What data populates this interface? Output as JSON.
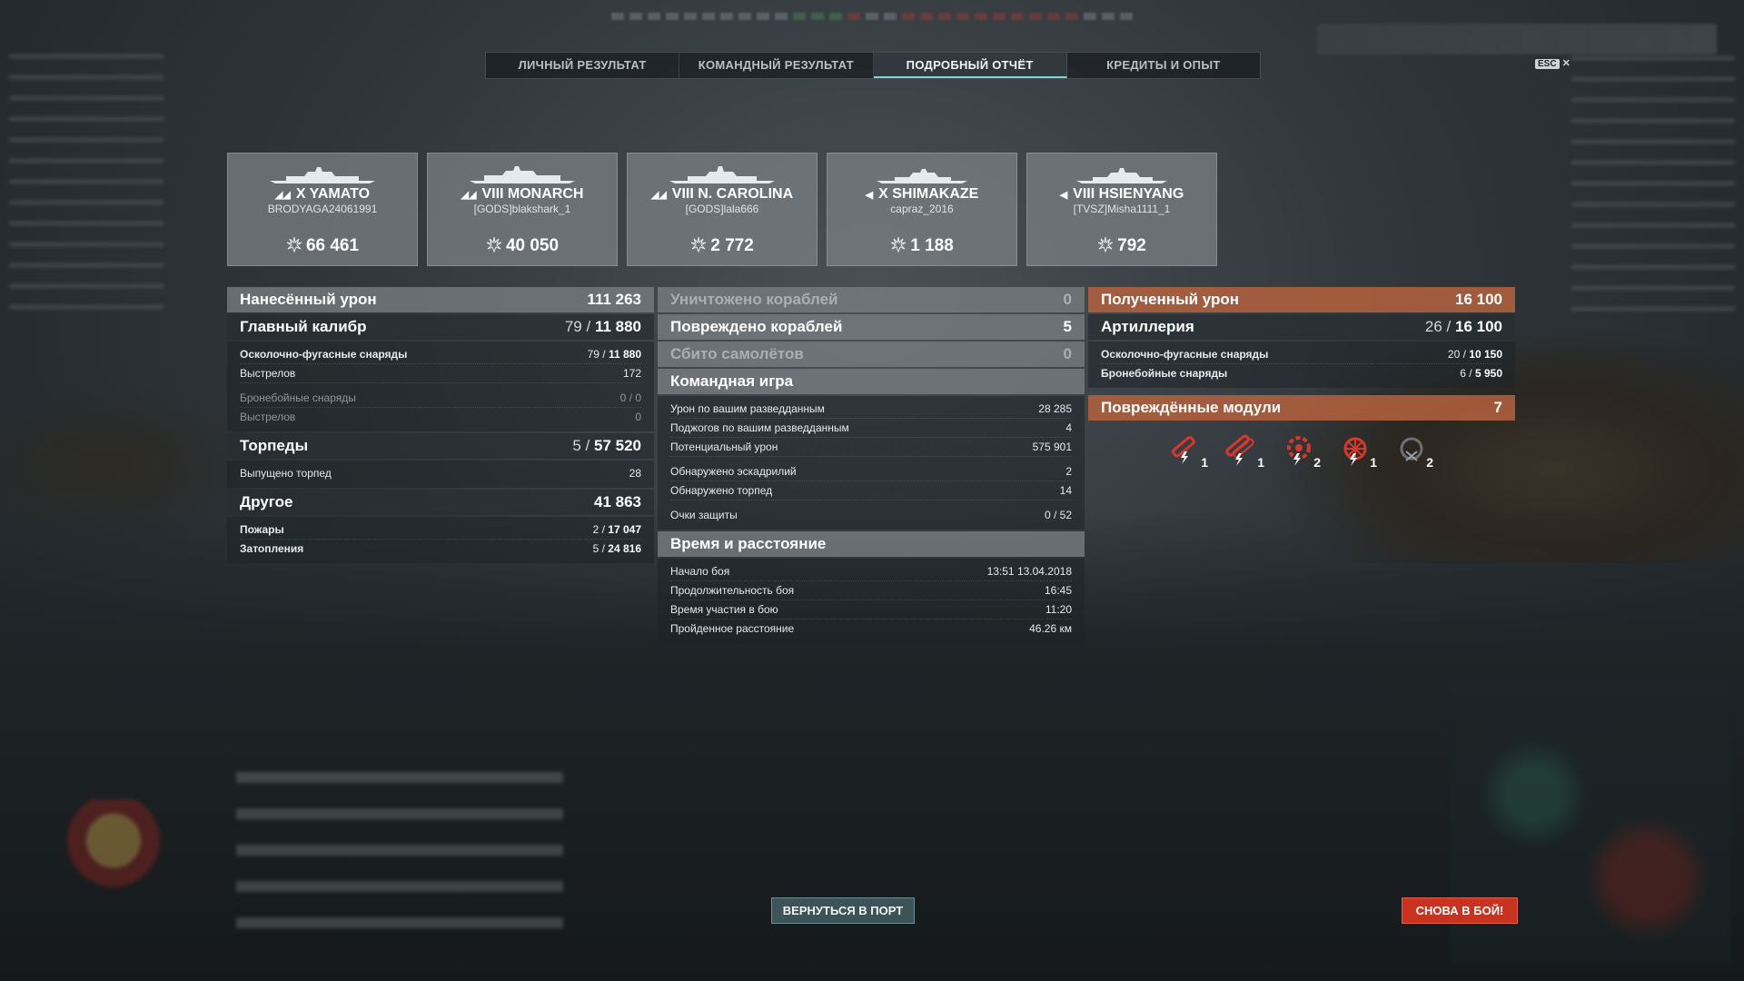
{
  "tabs": [
    "ЛИЧНЫЙ РЕЗУЛЬТАТ",
    "КОМАНДНЫЙ РЕЗУЛЬТАТ",
    "ПОДРОБНЫЙ ОТЧЁТ",
    "КРЕДИТЫ И ОПЫТ"
  ],
  "active_tab": "ПОДРОБНЫЙ ОТЧЁТ",
  "esc": {
    "key": "ESC",
    "close": "✕"
  },
  "ships": [
    {
      "name": "X YAMATO",
      "player": "BRODYAGA24061991",
      "damage": "66 461",
      "class_icon": "battleship-icon"
    },
    {
      "name": "VIII MONARCH",
      "player": "[GODS]blakshark_1",
      "damage": "40 050",
      "class_icon": "battleship-icon"
    },
    {
      "name": "VIII N. CAROLINA",
      "player": "[GODS]lala666",
      "damage": "2 772",
      "class_icon": "battleship-icon"
    },
    {
      "name": "X SHIMAKAZE",
      "player": "capraz_2016",
      "damage": "1 188",
      "class_icon": "destroyer-icon"
    },
    {
      "name": "VIII HSIENYANG",
      "player": "[TVSZ]Misha1111_1",
      "damage": "792",
      "class_icon": "destroyer-icon"
    }
  ],
  "col1": {
    "dealt": {
      "label": "Нанесённый урон",
      "value": "111 263"
    },
    "main": {
      "label": "Главный калибр",
      "hits": "79",
      "sep": "/",
      "dmg": "11 880"
    },
    "he": {
      "label": "Осколочно-фугасные снаряды",
      "hits": "79",
      "sep": "/",
      "dmg": "11 880"
    },
    "he_shots": {
      "label": "Выстрелов",
      "value": "172"
    },
    "ap": {
      "label": "Бронебойные снаряды",
      "value": "0 / 0"
    },
    "ap_shots": {
      "label": "Выстрелов",
      "value": "0"
    },
    "torps": {
      "label": "Торпеды",
      "hits": "5",
      "sep": "/",
      "dmg": "57 520"
    },
    "torps_fired": {
      "label": "Выпущено торпед",
      "value": "28"
    },
    "other": {
      "label": "Другое",
      "value": "41 863"
    },
    "fires": {
      "label": "Пожары",
      "hits": "2",
      "sep": "/",
      "dmg": "17 047"
    },
    "floods": {
      "label": "Затопления",
      "hits": "5",
      "sep": "/",
      "dmg": "24 816"
    }
  },
  "col2": {
    "destroyed": {
      "label": "Уничтожено кораблей",
      "value": "0"
    },
    "damaged": {
      "label": "Повреждено кораблей",
      "value": "5"
    },
    "planes": {
      "label": "Сбито самолётов",
      "value": "0"
    },
    "team": {
      "label": "Командная игра"
    },
    "spot_dmg": {
      "label": "Урон по вашим разведданным",
      "value": "28 285"
    },
    "spot_fires": {
      "label": "Поджогов по вашим разведданным",
      "value": "4"
    },
    "potential": {
      "label": "Потенциальный урон",
      "value": "575 901"
    },
    "squads": {
      "label": "Обнаружено эскадрилий",
      "value": "2"
    },
    "torps_spotted": {
      "label": "Обнаружено торпед",
      "value": "14"
    },
    "defense": {
      "label": "Очки защиты",
      "value": "0 / 52"
    },
    "time": {
      "label": "Время и расстояние"
    },
    "start": {
      "label": "Начало боя",
      "value": "13:51  13.04.2018"
    },
    "duration": {
      "label": "Продолжительность боя",
      "value": "16:45"
    },
    "participation": {
      "label": "Время участия в бою",
      "value": "11:20"
    },
    "distance": {
      "label": "Пройденное расстояние",
      "value": "46.26 км"
    }
  },
  "col3": {
    "received": {
      "label": "Полученный урон",
      "value": "16 100"
    },
    "artillery": {
      "label": "Артиллерия",
      "hits": "26",
      "sep": "/",
      "dmg": "16 100"
    },
    "he": {
      "label": "Осколочно-фугасные снаряды",
      "hits": "20",
      "sep": "/",
      "dmg": "10 150"
    },
    "ap": {
      "label": "Бронебойные снаряды",
      "hits": "6",
      "sep": "/",
      "dmg": "5 950"
    },
    "modules": {
      "label": "Повреждённые модули",
      "value": "7"
    },
    "module_icons": [
      {
        "icon": "torpedo-tube-icon",
        "count": "1"
      },
      {
        "icon": "torpedo-tube-icon",
        "count": "1"
      },
      {
        "icon": "engine-icon",
        "count": "2"
      },
      {
        "icon": "steering-gear-icon",
        "count": "1"
      },
      {
        "icon": "main-battery-icon",
        "count": "2"
      }
    ]
  },
  "buttons": {
    "port": "ВЕРНУТЬСЯ В ПОРТ",
    "battle": "СНОВА В БОЙ!"
  },
  "colors": {
    "accent_orange": "#b0603e",
    "battle_red": "#c8321e",
    "active_tab": "#7fd7d4"
  }
}
